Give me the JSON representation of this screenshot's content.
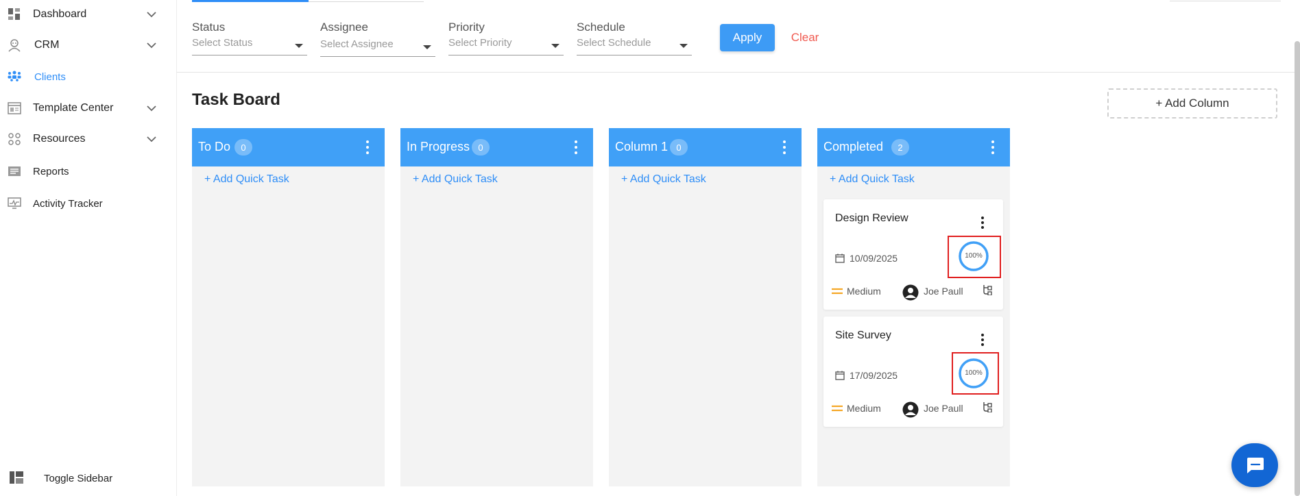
{
  "sidebar": {
    "items": [
      {
        "label": "Dashboard",
        "icon": "dashboard-icon",
        "has_chevron": true
      },
      {
        "label": "CRM",
        "icon": "crm-icon",
        "has_chevron": true
      },
      {
        "label": "Clients",
        "icon": "clients-icon",
        "has_chevron": false,
        "active": true
      },
      {
        "label": "Template Center",
        "icon": "template-icon",
        "has_chevron": true
      },
      {
        "label": "Resources",
        "icon": "resources-icon",
        "has_chevron": true
      },
      {
        "label": "Reports",
        "icon": "reports-icon",
        "has_chevron": false
      },
      {
        "label": "Activity Tracker",
        "icon": "activity-icon",
        "has_chevron": false
      }
    ],
    "toggle_label": "Toggle Sidebar"
  },
  "filters": {
    "status": {
      "label": "Status",
      "placeholder": "Select Status"
    },
    "assignee": {
      "label": "Assignee",
      "placeholder": "Select Assignee"
    },
    "priority": {
      "label": "Priority",
      "placeholder": "Select Priority"
    },
    "schedule": {
      "label": "Schedule",
      "placeholder": "Select Schedule"
    },
    "apply_label": "Apply",
    "clear_label": "Clear"
  },
  "board": {
    "title": "Task Board",
    "add_column_label": "+ Add Column",
    "quick_task_label": "+ Add Quick Task",
    "columns": [
      {
        "name": "To Do",
        "count": "0"
      },
      {
        "name": "In Progress",
        "count": "0"
      },
      {
        "name": "Column 1",
        "count": "0"
      },
      {
        "name": "Completed",
        "count": "2"
      }
    ],
    "tasks": [
      {
        "title": "Design Review",
        "date": "10/09/2025",
        "progress_label": "100%",
        "progress": 1.0,
        "priority": "Medium",
        "assignee": "Joe Paull"
      },
      {
        "title": "Site Survey",
        "date": "17/09/2025",
        "progress_label": "100%",
        "progress": 1.0,
        "priority": "Medium",
        "assignee": "Joe Paull"
      }
    ]
  },
  "colors": {
    "accent": "#2f8ef7",
    "column_header": "#40a0f7",
    "clear": "#f0594f",
    "priority_medium": "#f5a623",
    "highlight": "#e01e1e",
    "chat": "#1266d4"
  }
}
